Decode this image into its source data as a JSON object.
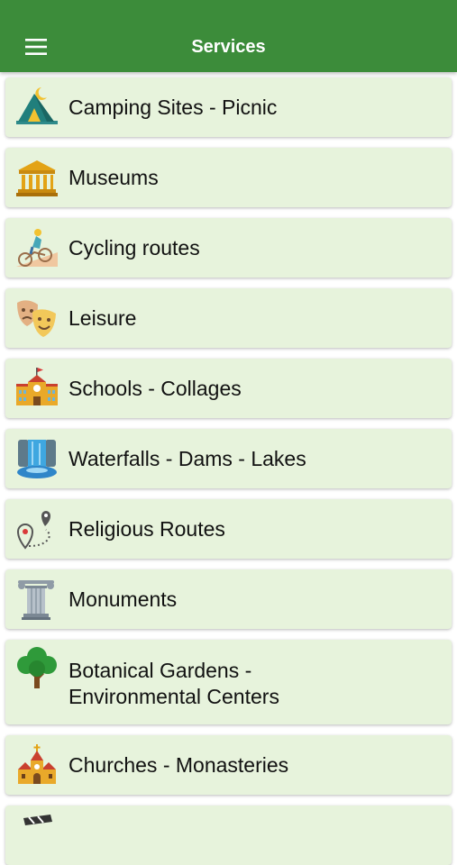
{
  "header": {
    "title": "Services"
  },
  "services": [
    {
      "label": "Camping Sites - Picnic",
      "icon": "tent-icon"
    },
    {
      "label": "Museums",
      "icon": "museum-icon"
    },
    {
      "label": "Cycling routes",
      "icon": "cyclist-icon"
    },
    {
      "label": "Leisure",
      "icon": "theater-masks-icon"
    },
    {
      "label": "Schools - Collages",
      "icon": "school-icon"
    },
    {
      "label": "Waterfalls - Dams - Lakes",
      "icon": "waterfall-icon"
    },
    {
      "label": "Religious Routes",
      "icon": "route-pins-icon"
    },
    {
      "label": "Monuments",
      "icon": "column-icon"
    },
    {
      "label_line1": "Botanical Gardens -",
      "label_line2": "Environmental Centers",
      "icon": "tree-icon"
    },
    {
      "label": "Churches - Monasteries",
      "icon": "church-icon"
    },
    {
      "label": "",
      "icon": "clapperboard-icon"
    }
  ],
  "colors": {
    "appbar": "#3c8c3a",
    "card": "#e7f3dc"
  }
}
